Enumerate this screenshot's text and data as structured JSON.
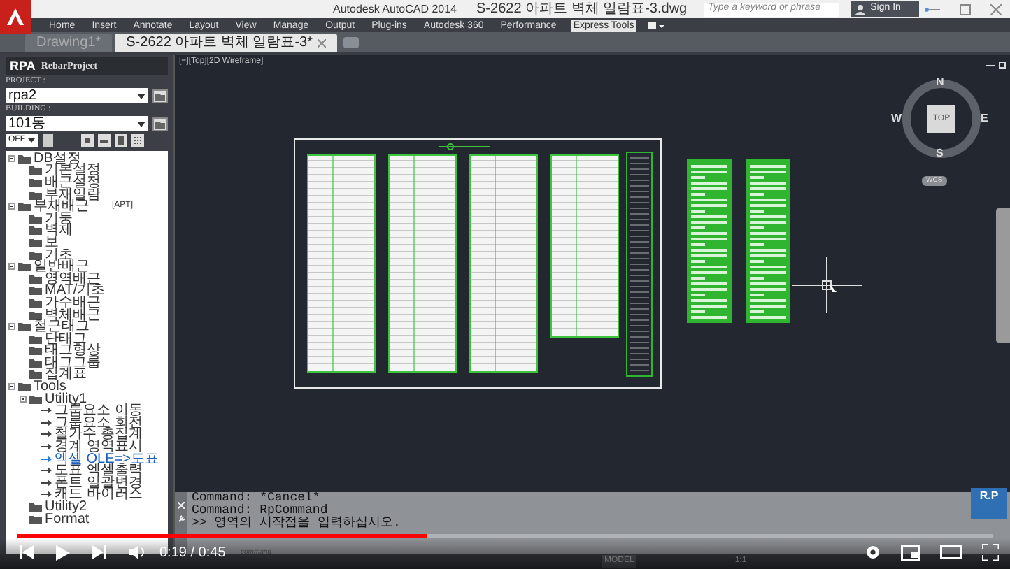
{
  "window": {
    "app_title": "Autodesk AutoCAD 2014",
    "file_title": "S-2622 아파트 벽체 일람표-3.dwg"
  },
  "search": {
    "placeholder": "Type a keyword or phrase"
  },
  "sign_in": "Sign In",
  "ribbon_tabs": [
    {
      "label": "Home",
      "selected": false
    },
    {
      "label": "Insert",
      "selected": false
    },
    {
      "label": "Annotate",
      "selected": false
    },
    {
      "label": "Layout",
      "selected": false
    },
    {
      "label": "View",
      "selected": false
    },
    {
      "label": "Manage",
      "selected": false
    },
    {
      "label": "Output",
      "selected": false
    },
    {
      "label": "Plug-ins",
      "selected": false
    },
    {
      "label": "Autodesk 360",
      "selected": false
    },
    {
      "label": "Performance",
      "selected": false
    },
    {
      "label": "Express Tools",
      "selected": true
    }
  ],
  "file_tabs": [
    {
      "label": "Drawing1*",
      "selected": false
    },
    {
      "label": "S-2622 아파트 벽체 일람표-3*",
      "selected": true
    }
  ],
  "panel": {
    "logo": "RPA",
    "title": "RebarProject",
    "project_label": "PROJECT :",
    "project_value": "rpa2",
    "building_label": "BUILDING :",
    "building_value": "101동",
    "mode": "OFF",
    "tree": [
      {
        "kind": "folder",
        "label": "DB설정",
        "selected": false,
        "children": [
          {
            "kind": "folder",
            "label": "기본설정",
            "selected": false
          },
          {
            "kind": "folder",
            "label": "배근설정",
            "selected": false
          },
          {
            "kind": "folder",
            "label": "부재일람",
            "selected": false
          }
        ]
      },
      {
        "kind": "folder",
        "label": "부재배근",
        "tag": "[APT]",
        "selected": false,
        "children": [
          {
            "kind": "folder",
            "label": "기둥",
            "selected": false
          },
          {
            "kind": "folder",
            "label": "벽체",
            "selected": false
          },
          {
            "kind": "folder",
            "label": "보",
            "selected": false
          },
          {
            "kind": "folder",
            "label": "기초",
            "selected": false
          }
        ]
      },
      {
        "kind": "folder",
        "label": "일반배근",
        "selected": false,
        "children": [
          {
            "kind": "folder",
            "label": "영역배근",
            "selected": false
          },
          {
            "kind": "folder",
            "label": "MAT/기초",
            "selected": false
          },
          {
            "kind": "folder",
            "label": "가수배근",
            "selected": false
          },
          {
            "kind": "folder",
            "label": "벽체배근",
            "selected": false
          }
        ]
      },
      {
        "kind": "folder",
        "label": "철근태그",
        "selected": false,
        "children": [
          {
            "kind": "folder",
            "label": "단태그",
            "selected": false
          },
          {
            "kind": "folder",
            "label": "태그형상",
            "selected": false
          },
          {
            "kind": "folder",
            "label": "태그그룹",
            "selected": false
          },
          {
            "kind": "folder",
            "label": "집계표",
            "selected": false
          }
        ]
      },
      {
        "kind": "folder",
        "label": "Tools",
        "selected": false,
        "children": [
          {
            "kind": "folder",
            "label": "Utility1",
            "selected": false,
            "children": [
              {
                "kind": "command",
                "label": "그룹요소 이동",
                "selected": false
              },
              {
                "kind": "command",
                "label": "그룹요소 회전",
                "selected": false
              },
              {
                "kind": "command",
                "label": "철가수 총집계",
                "selected": false
              },
              {
                "kind": "command",
                "label": "경계 영역표시",
                "selected": false
              },
              {
                "kind": "command",
                "label": "엑셀 OLE=>도표",
                "selected": true
              },
              {
                "kind": "command",
                "label": "도표 엑셀출력",
                "selected": false
              },
              {
                "kind": "command",
                "label": "폰트 일괄변경",
                "selected": false
              },
              {
                "kind": "command",
                "label": "캐드 바이러스",
                "selected": false
              }
            ]
          },
          {
            "kind": "folder",
            "label": "Utility2",
            "selected": false
          },
          {
            "kind": "folder",
            "label": "Format",
            "selected": false
          }
        ]
      }
    ]
  },
  "viewport": {
    "label": "[−][Top][2D Wireframe]",
    "compass": {
      "north": "N",
      "south": "S",
      "east": "E",
      "west": "W",
      "face": "TOP",
      "ucs": "WCS"
    }
  },
  "command_history": [
    "Command: *Cancel*",
    "Command: RpCommand",
    ">> 영역의 시작점을 입력하십시오."
  ],
  "command_input": {
    "placeholder": "command"
  },
  "status_bar": {
    "model": "MODEL",
    "scale": "1:1"
  },
  "watermark_logo": "R.P",
  "video": {
    "time": "0:19 / 0:45",
    "level": 0.42
  }
}
